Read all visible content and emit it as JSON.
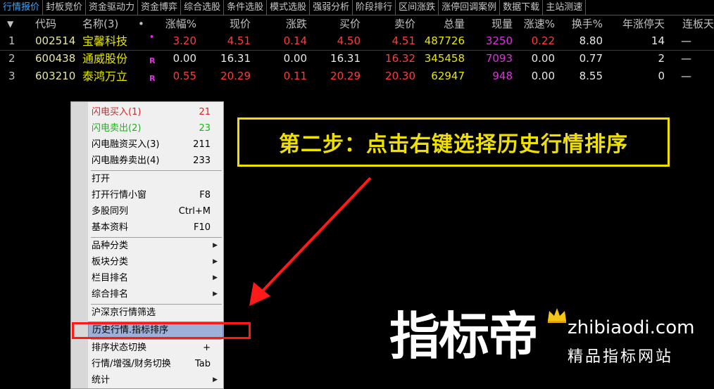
{
  "tabs": [
    {
      "label": "行情报价",
      "active": true
    },
    {
      "label": "封板竞价"
    },
    {
      "label": "资金驱动力"
    },
    {
      "label": "资金博弈"
    },
    {
      "label": "综合选股"
    },
    {
      "label": "条件选股"
    },
    {
      "label": "模式选股"
    },
    {
      "label": "强弱分析"
    },
    {
      "label": "阶段排行"
    },
    {
      "label": "区间涨跌"
    },
    {
      "label": "涨停回调案例"
    },
    {
      "label": "数据下载"
    },
    {
      "label": "主站测速"
    }
  ],
  "table": {
    "sort_indicator": "▼",
    "headers": {
      "code": "代码",
      "name": "名称(3)",
      "dot": "•",
      "chg_pct": "涨幅%",
      "price": "现价",
      "change": "涨跌",
      "bid": "买价",
      "ask": "卖价",
      "volume": "总量",
      "cur_vol": "现量",
      "speed": "涨速%",
      "turnover": "换手%",
      "year_up_days": "年涨停天",
      "consec": "连板天"
    },
    "rows": [
      {
        "idx": "1",
        "code": "002514",
        "name": "宝馨科技",
        "flag": "•",
        "chg_pct": "3.20",
        "price": "4.51",
        "change": "0.14",
        "bid": "4.50",
        "ask": "4.51",
        "volume": "487726",
        "cur_vol": "3250",
        "speed": "0.22",
        "turnover": "8.80",
        "year_up_days": "14",
        "consec": "—"
      },
      {
        "idx": "2",
        "code": "600438",
        "name": "通威股份",
        "flag": "R",
        "chg_pct": "0.00",
        "price": "16.31",
        "change": "0.00",
        "bid": "16.31",
        "ask": "16.32",
        "volume": "345458",
        "cur_vol": "7093",
        "speed": "0.00",
        "turnover": "0.77",
        "year_up_days": "2",
        "consec": "—"
      },
      {
        "idx": "3",
        "code": "603210",
        "name": "泰鸿万立",
        "flag": "R",
        "chg_pct": "0.55",
        "price": "20.29",
        "change": "0.11",
        "bid": "20.29",
        "ask": "20.30",
        "volume": "62947",
        "cur_vol": "948",
        "speed": "0.00",
        "turnover": "8.55",
        "year_up_days": "0",
        "consec": "—"
      }
    ]
  },
  "menu": {
    "items": [
      {
        "label": "闪电买入(1)",
        "key": "21"
      },
      {
        "label": "闪电卖出(2)",
        "key": "23"
      },
      {
        "label": "闪电融资买入(3)",
        "key": "211"
      },
      {
        "label": "闪电融券卖出(4)",
        "key": "233"
      },
      {
        "label": "打开",
        "key": ""
      },
      {
        "label": "打开行情小窗",
        "key": "F8"
      },
      {
        "label": "多股同列",
        "key": "Ctrl+M"
      },
      {
        "label": "基本资料",
        "key": "F10"
      },
      {
        "label": "品种分类",
        "key": ""
      },
      {
        "label": "板块分类",
        "key": ""
      },
      {
        "label": "栏目排名",
        "key": ""
      },
      {
        "label": "综合排名",
        "key": ""
      },
      {
        "label": "沪深京行情筛选",
        "key": ""
      },
      {
        "label": "历史行情.指标排序",
        "key": ""
      },
      {
        "label": "排序状态切换",
        "key": "+"
      },
      {
        "label": "行情/增强/财务切换",
        "key": "Tab"
      },
      {
        "label": "统计",
        "key": ""
      }
    ]
  },
  "annotation": {
    "text": "第二步：点击右键选择历史行情排序"
  },
  "watermark": {
    "brand": "指标帝",
    "url": "zhibiaodi.com",
    "slogan": "精品指标网站"
  },
  "colors": {
    "accent_red": "#ff1a1a",
    "callout_yellow": "#f0e000",
    "tab_active": "#3aa8ff"
  }
}
